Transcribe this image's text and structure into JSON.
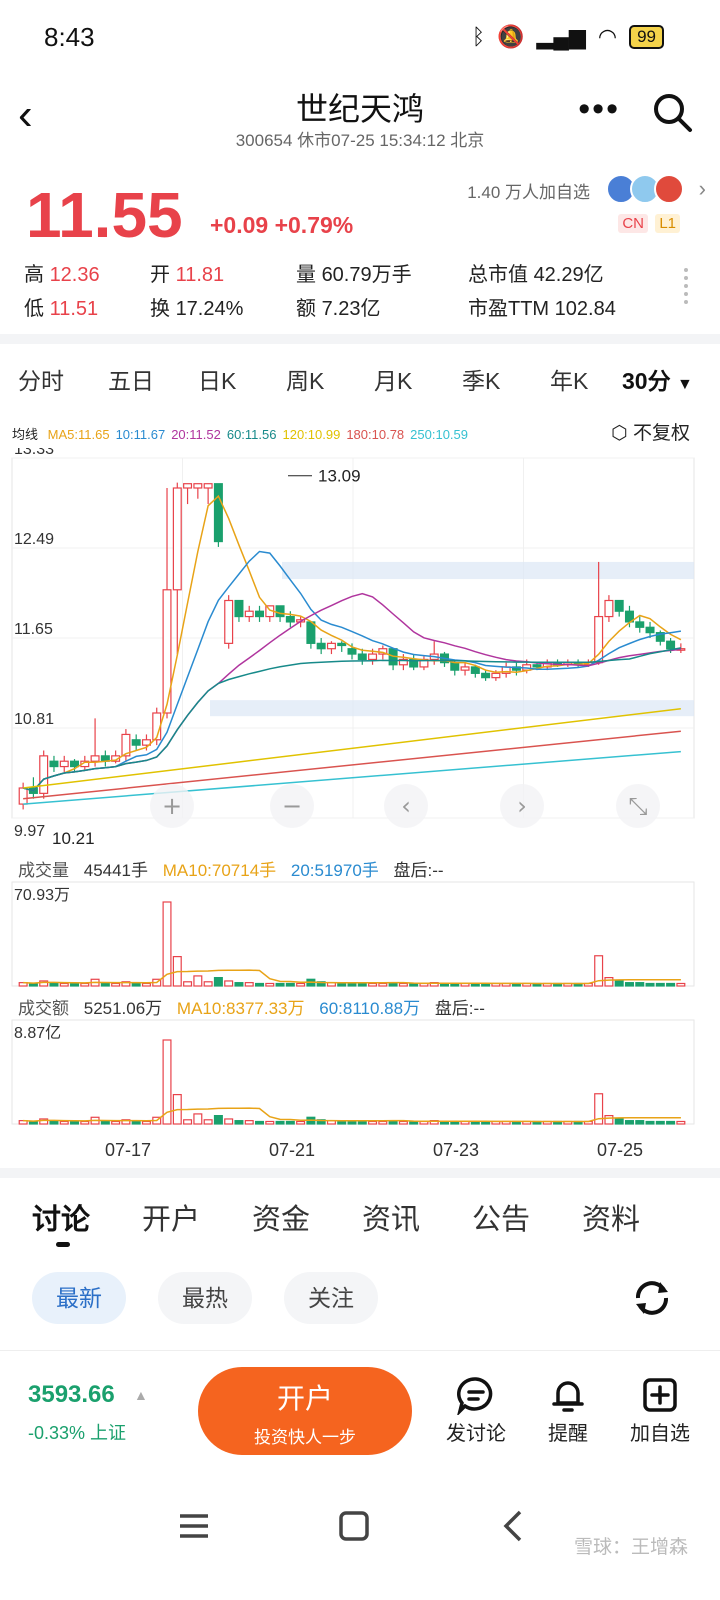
{
  "status": {
    "time": "8:43",
    "battery": "99"
  },
  "header": {
    "title": "世纪天鸿",
    "subtitle": "300654 休市07-25 15:34:12 北京"
  },
  "quote": {
    "price": "11.55",
    "change": "+0.09 +0.79%",
    "followers": "1.40 万人加自选",
    "tag_cn": "CN",
    "tag_l1": "L1",
    "stats": {
      "high_label": "高",
      "high": "12.36",
      "open_label": "开",
      "open": "11.81",
      "volume_label": "量",
      "volume": "60.79万手",
      "mktcap_label": "总市值",
      "mktcap": "42.29亿",
      "low_label": "低",
      "low": "11.51",
      "turnover_label": "换",
      "turnover": "17.24%",
      "amount_label": "额",
      "amount": "7.23亿",
      "pe_label": "市盈TTM",
      "pe": "102.84"
    }
  },
  "periods": [
    "分时",
    "五日",
    "日K",
    "周K",
    "月K",
    "季K",
    "年K",
    "30分"
  ],
  "ma_legend": {
    "label": "均线",
    "items": [
      {
        "text": "MA5:11.65",
        "color": "#e8a317"
      },
      {
        "text": "10:11.67",
        "color": "#2a8bd0"
      },
      {
        "text": "20:11.52",
        "color": "#b0359e"
      },
      {
        "text": "60:11.56",
        "color": "#178a8a"
      },
      {
        "text": "120:10.99",
        "color": "#e0c200"
      },
      {
        "text": "180:10.78",
        "color": "#d9534f"
      },
      {
        "text": "250:10.59",
        "color": "#36c1d1"
      }
    ],
    "restore": "不复权"
  },
  "chart_data": {
    "type": "candlestick",
    "y_ticks": [
      "13.33",
      "12.49",
      "11.65",
      "10.81",
      "9.97"
    ],
    "ylim": [
      9.97,
      13.33
    ],
    "max_label": "13.09",
    "min_label": "10.21",
    "x_ticks": [
      "07-17",
      "07-21",
      "07-23",
      "07-25"
    ],
    "up_color": "#e8424a",
    "down_color": "#1aa06d",
    "candles": [
      [
        10.1,
        10.25,
        10.05,
        10.3
      ],
      [
        10.25,
        10.2,
        10.15,
        10.35
      ],
      [
        10.2,
        10.55,
        10.15,
        10.6
      ],
      [
        10.5,
        10.45,
        10.4,
        10.55
      ],
      [
        10.45,
        10.5,
        10.4,
        10.55
      ],
      [
        10.5,
        10.45,
        10.4,
        10.52
      ],
      [
        10.45,
        10.5,
        10.42,
        10.55
      ],
      [
        10.5,
        10.55,
        10.45,
        10.9
      ],
      [
        10.55,
        10.5,
        10.45,
        10.6
      ],
      [
        10.5,
        10.55,
        10.48,
        10.6
      ],
      [
        10.55,
        10.75,
        10.5,
        10.8
      ],
      [
        10.7,
        10.65,
        10.6,
        10.75
      ],
      [
        10.65,
        10.7,
        10.6,
        10.75
      ],
      [
        10.7,
        10.95,
        10.65,
        11.0
      ],
      [
        10.95,
        12.1,
        10.9,
        13.05
      ],
      [
        12.1,
        13.05,
        11.5,
        13.1
      ],
      [
        13.05,
        13.09,
        12.9,
        13.09
      ],
      [
        13.05,
        13.09,
        12.95,
        13.09
      ],
      [
        13.05,
        13.09,
        12.9,
        13.09
      ],
      [
        13.09,
        12.55,
        12.5,
        13.09
      ],
      [
        11.6,
        12.0,
        11.55,
        12.05
      ],
      [
        12.0,
        11.85,
        11.8,
        12.0
      ],
      [
        11.85,
        11.9,
        11.8,
        11.95
      ],
      [
        11.9,
        11.85,
        11.8,
        11.95
      ],
      [
        11.85,
        11.95,
        11.8,
        11.95
      ],
      [
        11.95,
        11.85,
        11.8,
        11.95
      ],
      [
        11.85,
        11.8,
        11.75,
        11.9
      ],
      [
        11.8,
        11.82,
        11.75,
        11.85
      ],
      [
        11.8,
        11.6,
        11.55,
        11.8
      ],
      [
        11.6,
        11.55,
        11.5,
        11.65
      ],
      [
        11.55,
        11.6,
        11.5,
        11.62
      ],
      [
        11.6,
        11.58,
        11.52,
        11.62
      ],
      [
        11.55,
        11.5,
        11.45,
        11.6
      ],
      [
        11.5,
        11.45,
        11.4,
        11.55
      ],
      [
        11.45,
        11.5,
        11.4,
        11.55
      ],
      [
        11.5,
        11.55,
        11.45,
        11.58
      ],
      [
        11.55,
        11.4,
        11.35,
        11.55
      ],
      [
        11.4,
        11.45,
        11.35,
        11.5
      ],
      [
        11.45,
        11.38,
        11.35,
        11.5
      ],
      [
        11.38,
        11.45,
        11.35,
        11.48
      ],
      [
        11.45,
        11.5,
        11.4,
        11.62
      ],
      [
        11.5,
        11.42,
        11.38,
        11.52
      ],
      [
        11.42,
        11.35,
        11.3,
        11.45
      ],
      [
        11.35,
        11.38,
        11.3,
        11.42
      ],
      [
        11.38,
        11.32,
        11.28,
        11.4
      ],
      [
        11.32,
        11.28,
        11.25,
        11.35
      ],
      [
        11.28,
        11.32,
        11.25,
        11.35
      ],
      [
        11.32,
        11.38,
        11.28,
        11.42
      ],
      [
        11.38,
        11.35,
        11.3,
        11.42
      ],
      [
        11.35,
        11.4,
        11.32,
        11.45
      ],
      [
        11.4,
        11.38,
        11.35,
        11.42
      ],
      [
        11.38,
        11.42,
        11.35,
        11.45
      ],
      [
        11.42,
        11.4,
        11.38,
        11.45
      ],
      [
        11.4,
        11.42,
        11.38,
        11.45
      ],
      [
        11.42,
        11.4,
        11.38,
        11.45
      ],
      [
        11.4,
        11.42,
        11.38,
        11.45
      ],
      [
        11.42,
        11.85,
        11.4,
        12.36
      ],
      [
        11.85,
        12.0,
        11.8,
        12.05
      ],
      [
        12.0,
        11.9,
        11.85,
        12.0
      ],
      [
        11.9,
        11.8,
        11.75,
        11.95
      ],
      [
        11.8,
        11.75,
        11.7,
        11.85
      ],
      [
        11.75,
        11.7,
        11.65,
        11.8
      ],
      [
        11.7,
        11.62,
        11.58,
        11.72
      ],
      [
        11.62,
        11.55,
        11.51,
        11.65
      ],
      [
        11.55,
        11.55,
        11.51,
        11.6
      ]
    ],
    "volume": {
      "label": "成交量",
      "value": "45441手",
      "ma10": "MA10:70714手",
      "ma20": "20:51970手",
      "after": "盘后:--",
      "max_tick": "70.93万"
    },
    "amount": {
      "label": "成交额",
      "value": "5251.06万",
      "ma10": "MA10:8377.33万",
      "ma60": "60:8110.88万",
      "after": "盘后:--",
      "max_tick": "8.87亿"
    },
    "bars": [
      4,
      3,
      6,
      4,
      3,
      3,
      3,
      8,
      3,
      3,
      5,
      3,
      3,
      8,
      100,
      35,
      5,
      12,
      5,
      10,
      6,
      4,
      4,
      3,
      3,
      3,
      3,
      3,
      8,
      5,
      4,
      3,
      4,
      3,
      3,
      3,
      4,
      3,
      3,
      3,
      4,
      3,
      3,
      3,
      3,
      3,
      3,
      3,
      3,
      3,
      3,
      3,
      3,
      3,
      3,
      3,
      36,
      10,
      6,
      4,
      4,
      3,
      3,
      3,
      3
    ]
  },
  "news_tabs": [
    "讨论",
    "开户",
    "资金",
    "资讯",
    "公告",
    "资料"
  ],
  "filters": [
    "最新",
    "最热",
    "关注"
  ],
  "bottom": {
    "index_value": "3593.66",
    "index_sub": "-0.33% 上证",
    "open_title": "开户",
    "open_sub": "投资快人一步",
    "actions": [
      "发讨论",
      "提醒",
      "加自选"
    ]
  },
  "watermark": "雪球：王增森"
}
